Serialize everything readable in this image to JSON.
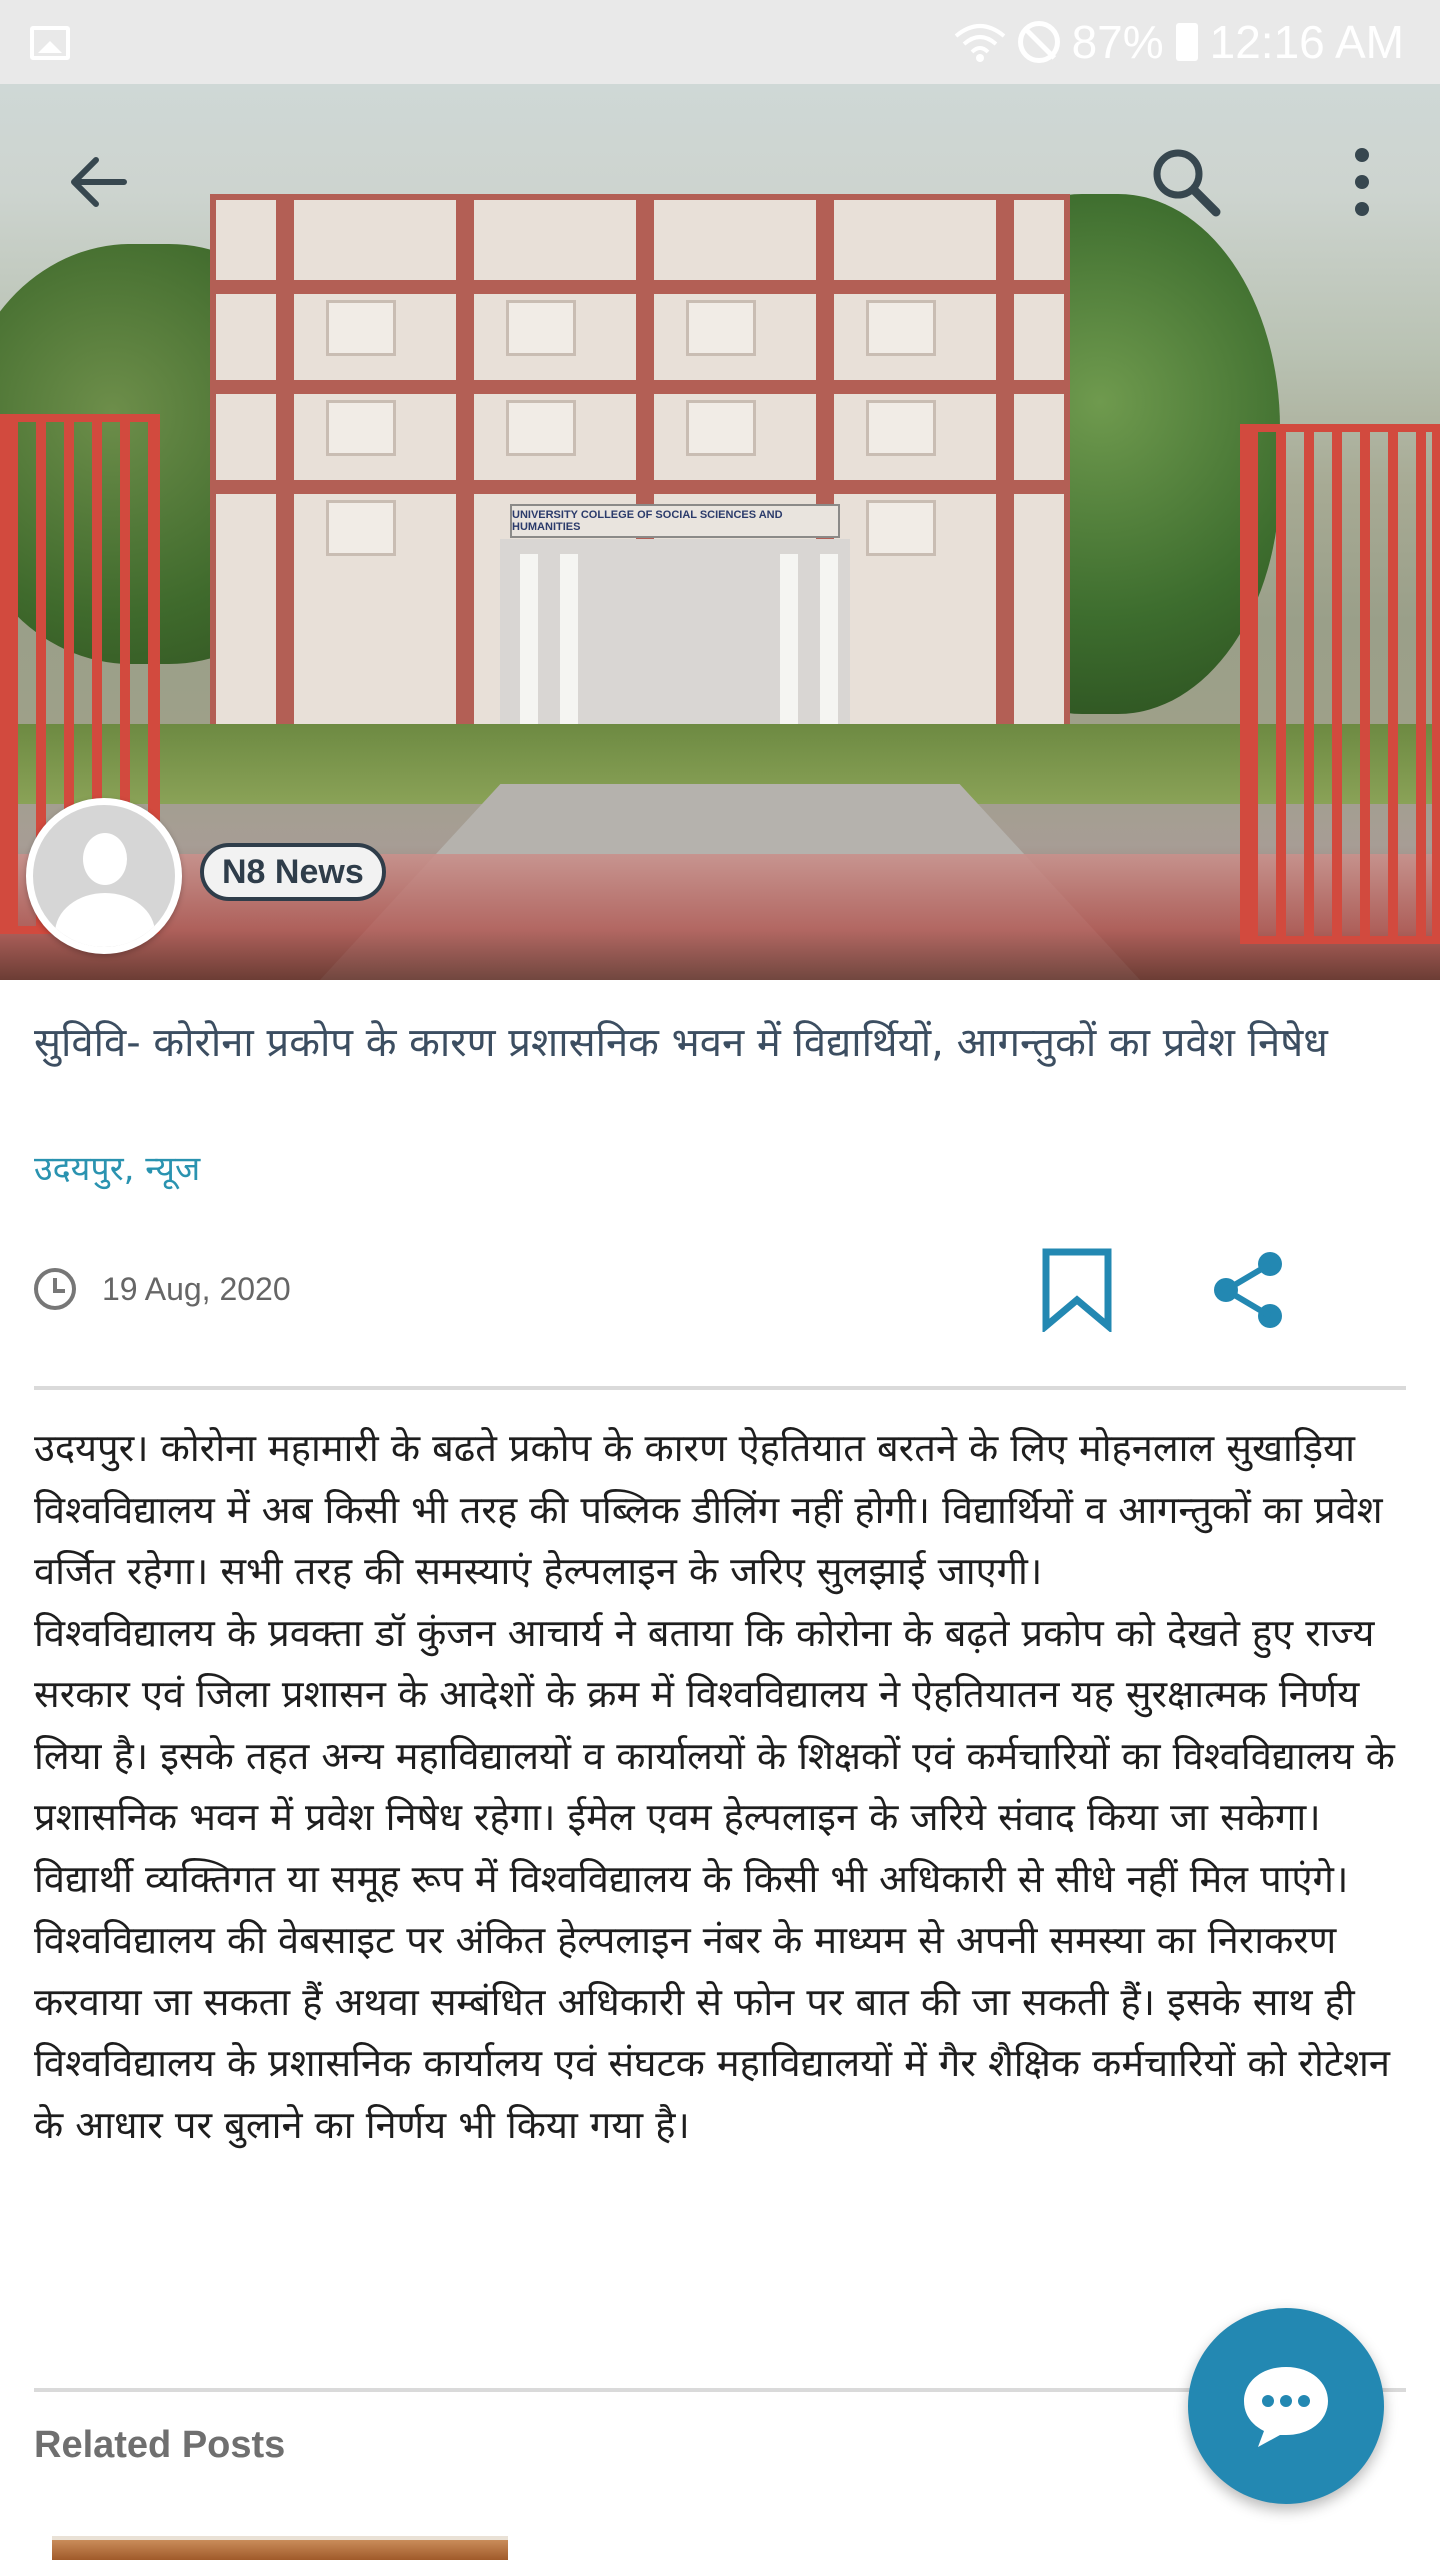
{
  "status_bar": {
    "battery": "87%",
    "time": "12:16 AM"
  },
  "hero": {
    "building_sign": "UNIVERSITY COLLEGE OF SOCIAL SCIENCES AND HUMANITIES",
    "source_name": "N8 News"
  },
  "icons": {
    "back": "arrow-left-icon",
    "search": "search-icon",
    "more": "more-vertical-icon",
    "clock": "clock-icon",
    "bookmark": "bookmark-icon",
    "share": "share-icon",
    "chat": "chat-bubble-icon"
  },
  "colors": {
    "accent": "#2388b2",
    "title": "#3c4e61",
    "category": "#2a93b0"
  },
  "article": {
    "title": "सुविवि- कोरोना प्रकोप के कारण प्रशासनिक भवन में विद्यार्थियों, आगन्तुकों का प्रवेश निषेध",
    "category": "उदयपुर, न्यूज",
    "date": "19 Aug, 2020",
    "paragraphs": [
      "उदयपुर। कोरोना महामारी के बढते प्रकोप के कारण ऐहतियात बरतने के लिए मोहनलाल सुखाड़िया विश्वविद्यालय में अब किसी भी तरह की पब्लिक डीलिंग नहीं होगी। विद्यार्थियों व आगन्तुकों का प्रवेश वर्जित रहेगा। सभी तरह की समस्याएं हेल्पलाइन के जरिए सुलझाई जाएगी।",
      "विश्वविद्यालय के प्रवक्ता डॉ कुंजन आचार्य ने बताया कि कोरोना के बढ़ते प्रकोप को देखते हुए राज्य सरकार एवं जिला प्रशासन के आदेशों के क्रम में विश्वविद्यालय ने ऐहतियातन यह सुरक्षात्मक निर्णय लिया है। इसके तहत अन्य महाविद्यालयों व कार्यालयों के शिक्षकों एवं कर्मचारियों का विश्वविद्यालय के प्रशासनिक भवन में प्रवेश निषेध रहेगा। ईमेल एवम हेल्पलाइन के जरिये संवाद किया जा सकेगा। विद्यार्थी व्यक्तिगत या समूह रूप में विश्वविद्यालय के किसी भी अधिकारी से सीधे नहीं मिल पाएंगे। विश्वविद्यालय की वेबसाइट पर अंकित हेल्पलाइन नंबर के माध्यम से अपनी समस्या का निराकरण करवाया जा सकता हैं अथवा सम्बंधित अधिकारी से फोन पर बात की जा सकती हैं। इसके साथ ही विश्वविद्यालय के प्रशासनिक कार्यालय एवं संघटक महाविद्यालयों में गैर शैक्षिक कर्मचारियों को रोटेशन के आधार पर बुलाने का निर्णय भी किया गया है।"
    ]
  },
  "related": {
    "heading": "Related Posts"
  }
}
